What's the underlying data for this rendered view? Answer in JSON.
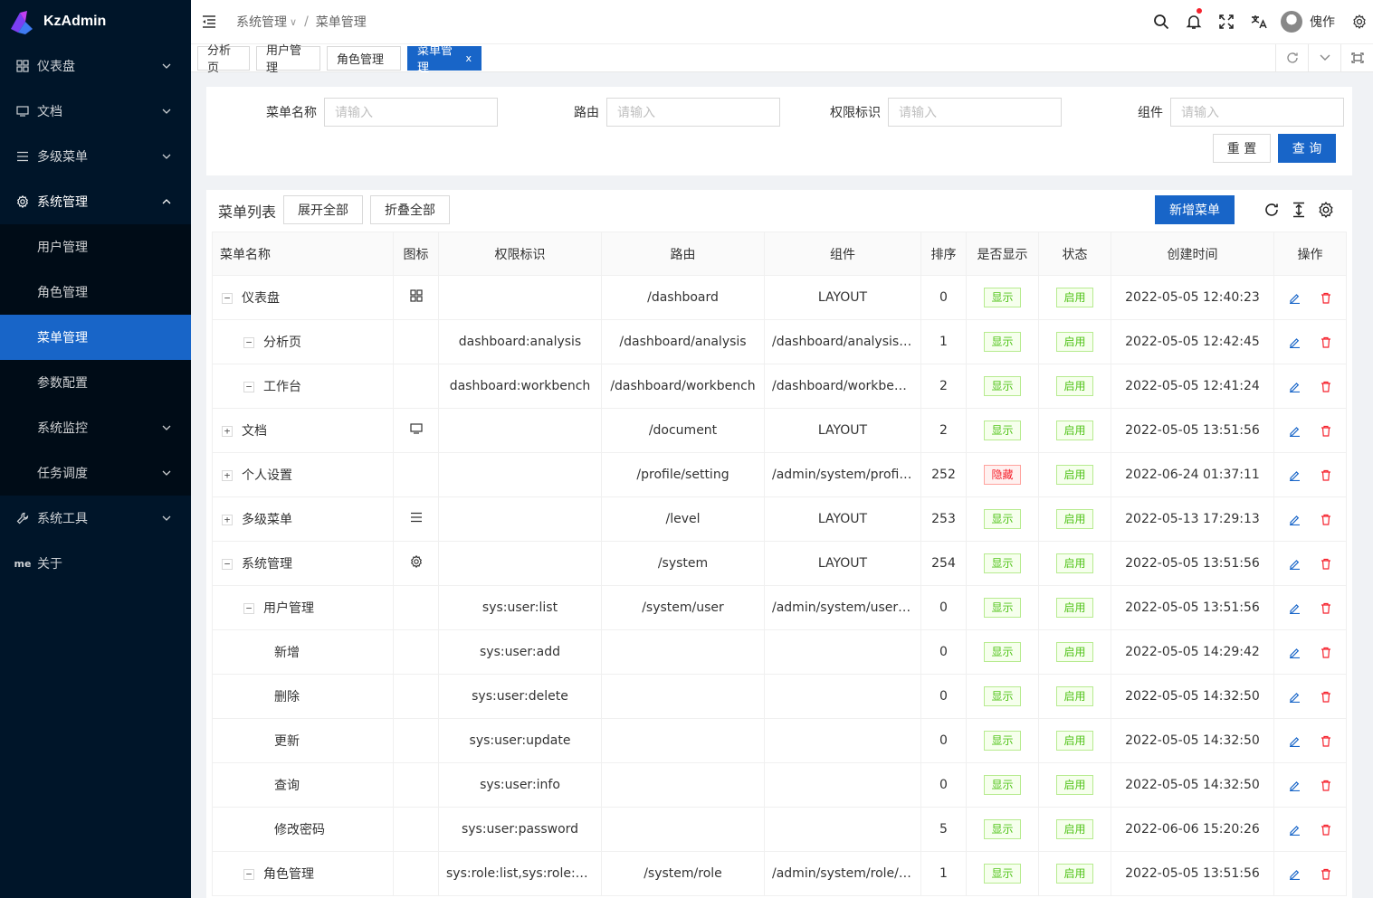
{
  "app": {
    "title": "KzAdmin"
  },
  "sidebar": {
    "items": [
      {
        "label": "仪表盘",
        "icon": "grid-icon",
        "expandable": true
      },
      {
        "label": "文档",
        "icon": "monitor-icon",
        "expandable": true
      },
      {
        "label": "多级菜单",
        "icon": "menu-icon",
        "expandable": true
      },
      {
        "label": "系统管理",
        "icon": "gear-icon",
        "expandable": true,
        "open": true
      },
      {
        "label": "系统工具",
        "icon": "tool-icon",
        "expandable": true
      },
      {
        "label": "关于",
        "icon": "me-icon",
        "icon_text": "me",
        "expandable": false
      }
    ],
    "sub_items": [
      {
        "label": "用户管理",
        "expandable": false
      },
      {
        "label": "角色管理",
        "expandable": false
      },
      {
        "label": "菜单管理",
        "expandable": false,
        "active": true
      },
      {
        "label": "参数配置",
        "expandable": false
      },
      {
        "label": "系统监控",
        "expandable": true
      },
      {
        "label": "任务调度",
        "expandable": true
      }
    ]
  },
  "header": {
    "breadcrumb": [
      "系统管理",
      "菜单管理"
    ],
    "user_name": "傀作"
  },
  "tabs": [
    {
      "label": "分析页"
    },
    {
      "label": "用户管理"
    },
    {
      "label": "角色管理"
    },
    {
      "label": "菜单管理",
      "active": true,
      "close": "x"
    }
  ],
  "search": {
    "fields": [
      {
        "label": "菜单名称",
        "placeholder": "请输入"
      },
      {
        "label": "路由",
        "placeholder": "请输入"
      },
      {
        "label": "权限标识",
        "placeholder": "请输入"
      },
      {
        "label": "组件",
        "placeholder": "请输入"
      }
    ],
    "reset_label": "重 置",
    "query_label": "查 询"
  },
  "table_card": {
    "title": "菜单列表",
    "expand_all": "展开全部",
    "collapse_all": "折叠全部",
    "add_label": "新增菜单"
  },
  "columns": [
    "菜单名称",
    "图标",
    "权限标识",
    "路由",
    "组件",
    "排序",
    "是否显示",
    "状态",
    "创建时间",
    "操作"
  ],
  "rows": [
    {
      "level": 0,
      "toggle": "−",
      "name": "仪表盘",
      "icon": "grid-icon",
      "perm": "",
      "route": "/dashboard",
      "component": "LAYOUT",
      "order": "0",
      "show": "显示",
      "status": "启用",
      "created": "2022-05-05 12:40:23"
    },
    {
      "level": 1,
      "toggle": "−",
      "name": "分析页",
      "icon": "",
      "perm": "dashboard:analysis",
      "route": "/dashboard/analysis",
      "component": "/dashboard/analysis/in...",
      "order": "1",
      "show": "显示",
      "status": "启用",
      "created": "2022-05-05 12:42:45"
    },
    {
      "level": 1,
      "toggle": "−",
      "name": "工作台",
      "icon": "",
      "perm": "dashboard:workbench",
      "route": "/dashboard/workbench",
      "component": "/dashboard/workbench...",
      "order": "2",
      "show": "显示",
      "status": "启用",
      "created": "2022-05-05 12:41:24"
    },
    {
      "level": 0,
      "toggle": "+",
      "name": "文档",
      "icon": "monitor-icon",
      "perm": "",
      "route": "/document",
      "component": "LAYOUT",
      "order": "2",
      "show": "显示",
      "status": "启用",
      "created": "2022-05-05 13:51:56"
    },
    {
      "level": 0,
      "toggle": "+",
      "name": "个人设置",
      "icon": "",
      "perm": "",
      "route": "/profile/setting",
      "component": "/admin/system/profile/...",
      "order": "252",
      "show": "隐藏",
      "status": "启用",
      "created": "2022-06-24 01:37:11"
    },
    {
      "level": 0,
      "toggle": "+",
      "name": "多级菜单",
      "icon": "menu-icon",
      "perm": "",
      "route": "/level",
      "component": "LAYOUT",
      "order": "253",
      "show": "显示",
      "status": "启用",
      "created": "2022-05-13 17:29:13"
    },
    {
      "level": 0,
      "toggle": "−",
      "name": "系统管理",
      "icon": "gear-icon",
      "perm": "",
      "route": "/system",
      "component": "LAYOUT",
      "order": "254",
      "show": "显示",
      "status": "启用",
      "created": "2022-05-05 13:51:56"
    },
    {
      "level": 1,
      "toggle": "−",
      "name": "用户管理",
      "icon": "",
      "perm": "sys:user:list",
      "route": "/system/user",
      "component": "/admin/system/user/in...",
      "order": "0",
      "show": "显示",
      "status": "启用",
      "created": "2022-05-05 13:51:56"
    },
    {
      "level": 2,
      "toggle": "",
      "name": "新增",
      "icon": "",
      "perm": "sys:user:add",
      "route": "",
      "component": "",
      "order": "0",
      "show": "显示",
      "status": "启用",
      "created": "2022-05-05 14:29:42"
    },
    {
      "level": 2,
      "toggle": "",
      "name": "删除",
      "icon": "",
      "perm": "sys:user:delete",
      "route": "",
      "component": "",
      "order": "0",
      "show": "显示",
      "status": "启用",
      "created": "2022-05-05 14:32:50"
    },
    {
      "level": 2,
      "toggle": "",
      "name": "更新",
      "icon": "",
      "perm": "sys:user:update",
      "route": "",
      "component": "",
      "order": "0",
      "show": "显示",
      "status": "启用",
      "created": "2022-05-05 14:32:50"
    },
    {
      "level": 2,
      "toggle": "",
      "name": "查询",
      "icon": "",
      "perm": "sys:user:info",
      "route": "",
      "component": "",
      "order": "0",
      "show": "显示",
      "status": "启用",
      "created": "2022-05-05 14:32:50"
    },
    {
      "level": 2,
      "toggle": "",
      "name": "修改密码",
      "icon": "",
      "perm": "sys:user:password",
      "route": "",
      "component": "",
      "order": "5",
      "show": "显示",
      "status": "启用",
      "created": "2022-06-06 15:20:26"
    },
    {
      "level": 1,
      "toggle": "−",
      "name": "角色管理",
      "icon": "",
      "perm": "sys:role:list,sys:role:page",
      "route": "/system/role",
      "component": "/admin/system/role/in...",
      "order": "1",
      "show": "显示",
      "status": "启用",
      "created": "2022-05-05 13:51:56"
    }
  ],
  "colors": {
    "sidebar": "#001529",
    "primary": "#1865c8",
    "success": "#52c41a",
    "danger": "#f5222d"
  }
}
